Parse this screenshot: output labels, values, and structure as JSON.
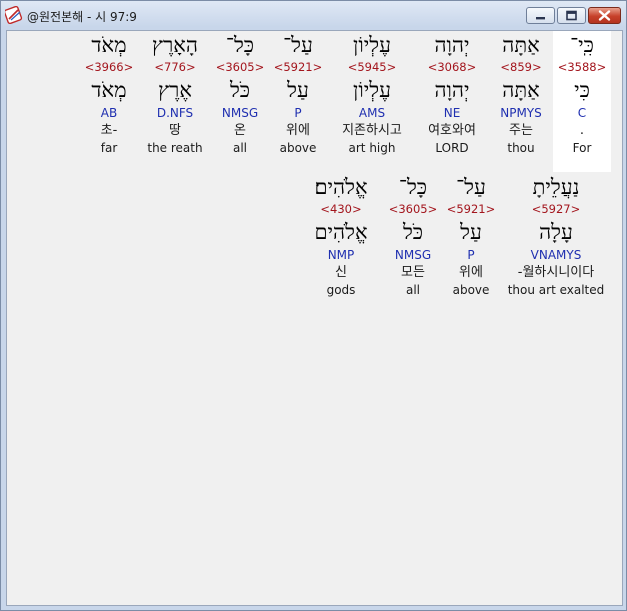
{
  "window": {
    "title": "@원전본해 - 시 97:9",
    "buttons": {
      "minimize": "minimize-icon",
      "maximize": "maximize-icon",
      "close": "close-icon"
    }
  },
  "colors": {
    "strongs": "#a3151d",
    "parsing": "#1f2fb0",
    "highlight": "#ffffff"
  },
  "rows": [
    {
      "words": [
        {
          "surface": "כִּֽי־",
          "strongs": "<3588>",
          "lexeme": "כִּי",
          "parsing": "C",
          "korean": ".",
          "english": "For",
          "highlight": true
        },
        {
          "surface": "אַתָּה",
          "strongs": "<859>",
          "lexeme": "אַתָּה",
          "parsing": "NPMYS",
          "korean": "주는",
          "english": "thou"
        },
        {
          "surface": "יְהוָה",
          "strongs": "<3068>",
          "lexeme": "יְהוָה",
          "parsing": "NE",
          "korean": "여호와여",
          "english": "LORD"
        },
        {
          "surface": "עֶלְיוֹן",
          "strongs": "<5945>",
          "lexeme": "עֶלְיוֹן",
          "parsing": "AMS",
          "korean": "지존하시고",
          "english": "art high"
        },
        {
          "surface": "עַל־",
          "strongs": "<5921>",
          "lexeme": "עַל",
          "parsing": "P",
          "korean": "위에",
          "english": "above"
        },
        {
          "surface": "כָּל־",
          "strongs": "<3605>",
          "lexeme": "כֹּל",
          "parsing": "NMSG",
          "korean": "온",
          "english": "all"
        },
        {
          "surface": "הָאָרֶץ",
          "strongs": "<776>",
          "lexeme": "אֶרֶץ",
          "parsing": "D.NFS",
          "korean": "땅",
          "english": "the reath"
        },
        {
          "surface": "מְאֹד",
          "strongs": "<3966>",
          "lexeme": "מְאֹד",
          "parsing": "AB",
          "korean": "초-",
          "english": "far"
        }
      ]
    },
    {
      "words": [
        {
          "surface": "נַעֲלֵיתָ",
          "strongs": "<5927>",
          "lexeme": "עָלָה",
          "parsing": "VNAMYS",
          "korean": "-월하시니이다",
          "english": "thou art exalted"
        },
        {
          "surface": "עַל־",
          "strongs": "<5921>",
          "lexeme": "עַל",
          "parsing": "P",
          "korean": "위에",
          "english": "above"
        },
        {
          "surface": "כָּל־",
          "strongs": "<3605>",
          "lexeme": "כֹּל",
          "parsing": "NMSG",
          "korean": "모든",
          "english": "all"
        },
        {
          "surface": "אֱלֹהִים׃",
          "strongs": "<430>",
          "lexeme": "אֱלֹהִים",
          "parsing": "NMP",
          "korean": "신",
          "english": "gods"
        }
      ]
    }
  ]
}
